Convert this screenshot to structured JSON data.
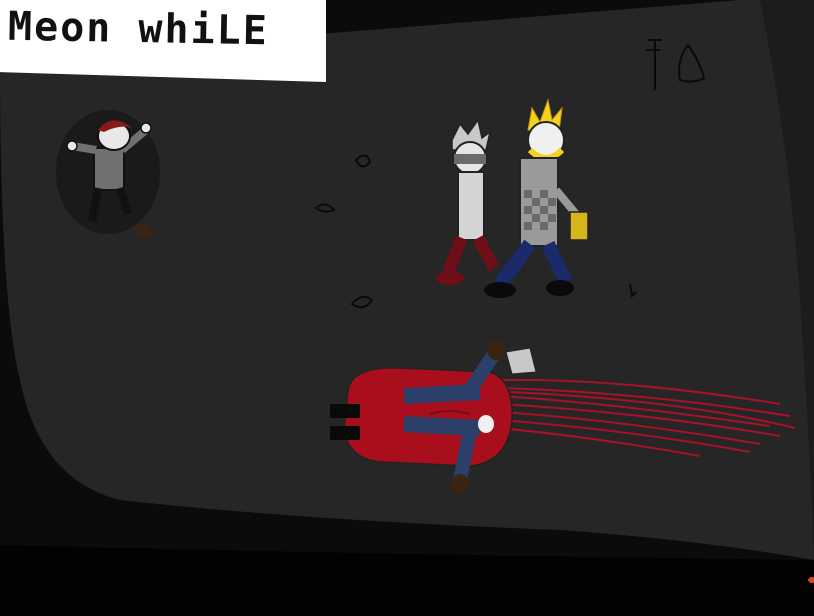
{
  "caption": {
    "text": "Meon whiLE"
  },
  "colors": {
    "cave_fill": "#242424",
    "floor_shadow": "#050505",
    "blood": "#b5102a",
    "caption_bg": "#ffffff"
  }
}
